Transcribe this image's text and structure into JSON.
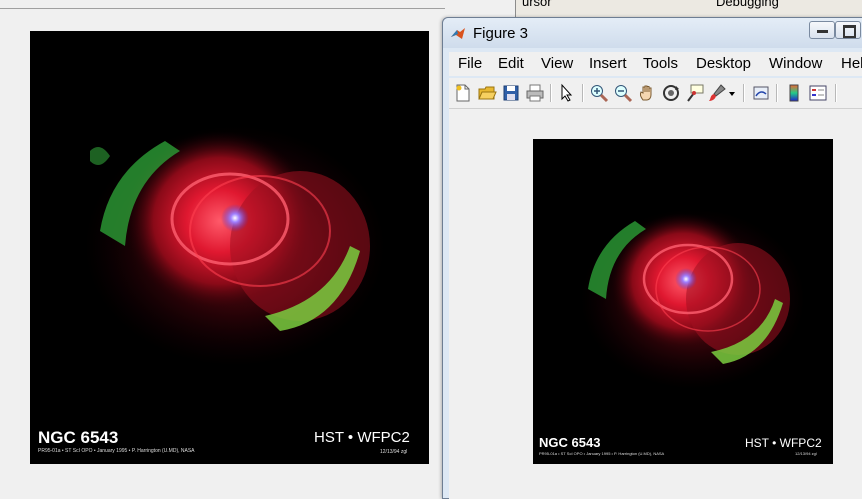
{
  "background_window": {
    "partial_labels": [
      "ursor",
      "Debugging"
    ]
  },
  "left_image": {
    "title": "NGC 6543",
    "subtitle": "PR95-01a • ST ScI OPO • January 1995 • P. Harrington (U.MD), NASA",
    "instrument": "HST • WFPC2",
    "date": "12/13/94 zgl"
  },
  "figure_window": {
    "title": "Figure 3",
    "menu": [
      "File",
      "Edit",
      "View",
      "Insert",
      "Tools",
      "Desktop",
      "Window",
      "Hel"
    ],
    "toolbar_icons": [
      "new-figure-icon",
      "open-file-icon",
      "save-icon",
      "print-icon",
      "pointer-icon",
      "zoom-in-icon",
      "zoom-out-icon",
      "pan-hand-icon",
      "rotate-3d-icon",
      "data-cursor-icon",
      "brush-icon",
      "brush-dropdown-icon",
      "link-plot-icon",
      "colorbar-icon",
      "legend-icon"
    ],
    "image": {
      "title": "NGC 6543",
      "subtitle": "PR95-01a • ST ScI OPO • January 1995 • P. Harrington (U.MD), NASA",
      "instrument": "HST • WFPC2",
      "date": "12/13/94 zgl"
    }
  }
}
